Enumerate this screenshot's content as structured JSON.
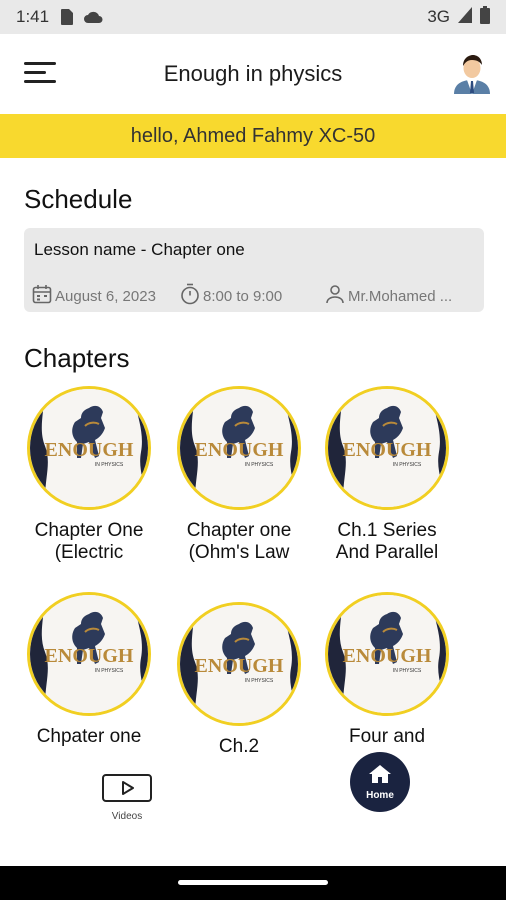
{
  "status_bar": {
    "time": "1:41",
    "network": "3G"
  },
  "app_bar": {
    "title": "Enough in physics"
  },
  "greeting": "hello, Ahmed Fahmy XC-50",
  "schedule": {
    "heading": "Schedule",
    "lesson": "Lesson name - Chapter one",
    "date": "August 6, 2023",
    "time": "8:00 to 9:00",
    "teacher": "Mr.Mohamed ..."
  },
  "chapters": {
    "heading": "Chapters",
    "logo_text": "ENOUGH",
    "logo_sub": "IN PHYSICS",
    "items": [
      {
        "name": "Chapter One (Electric"
      },
      {
        "name": "Chapter one (Ohm's Law"
      },
      {
        "name": "Ch.1 Series And Parallel"
      },
      {
        "name": "Chpater one"
      },
      {
        "name": "Ch.2"
      },
      {
        "name": "Four and"
      }
    ]
  },
  "bottom_nav": {
    "videos_label": "Videos",
    "home_label": "Home"
  },
  "colors": {
    "accent_yellow": "#f8d92e",
    "navy": "#1a2340"
  }
}
